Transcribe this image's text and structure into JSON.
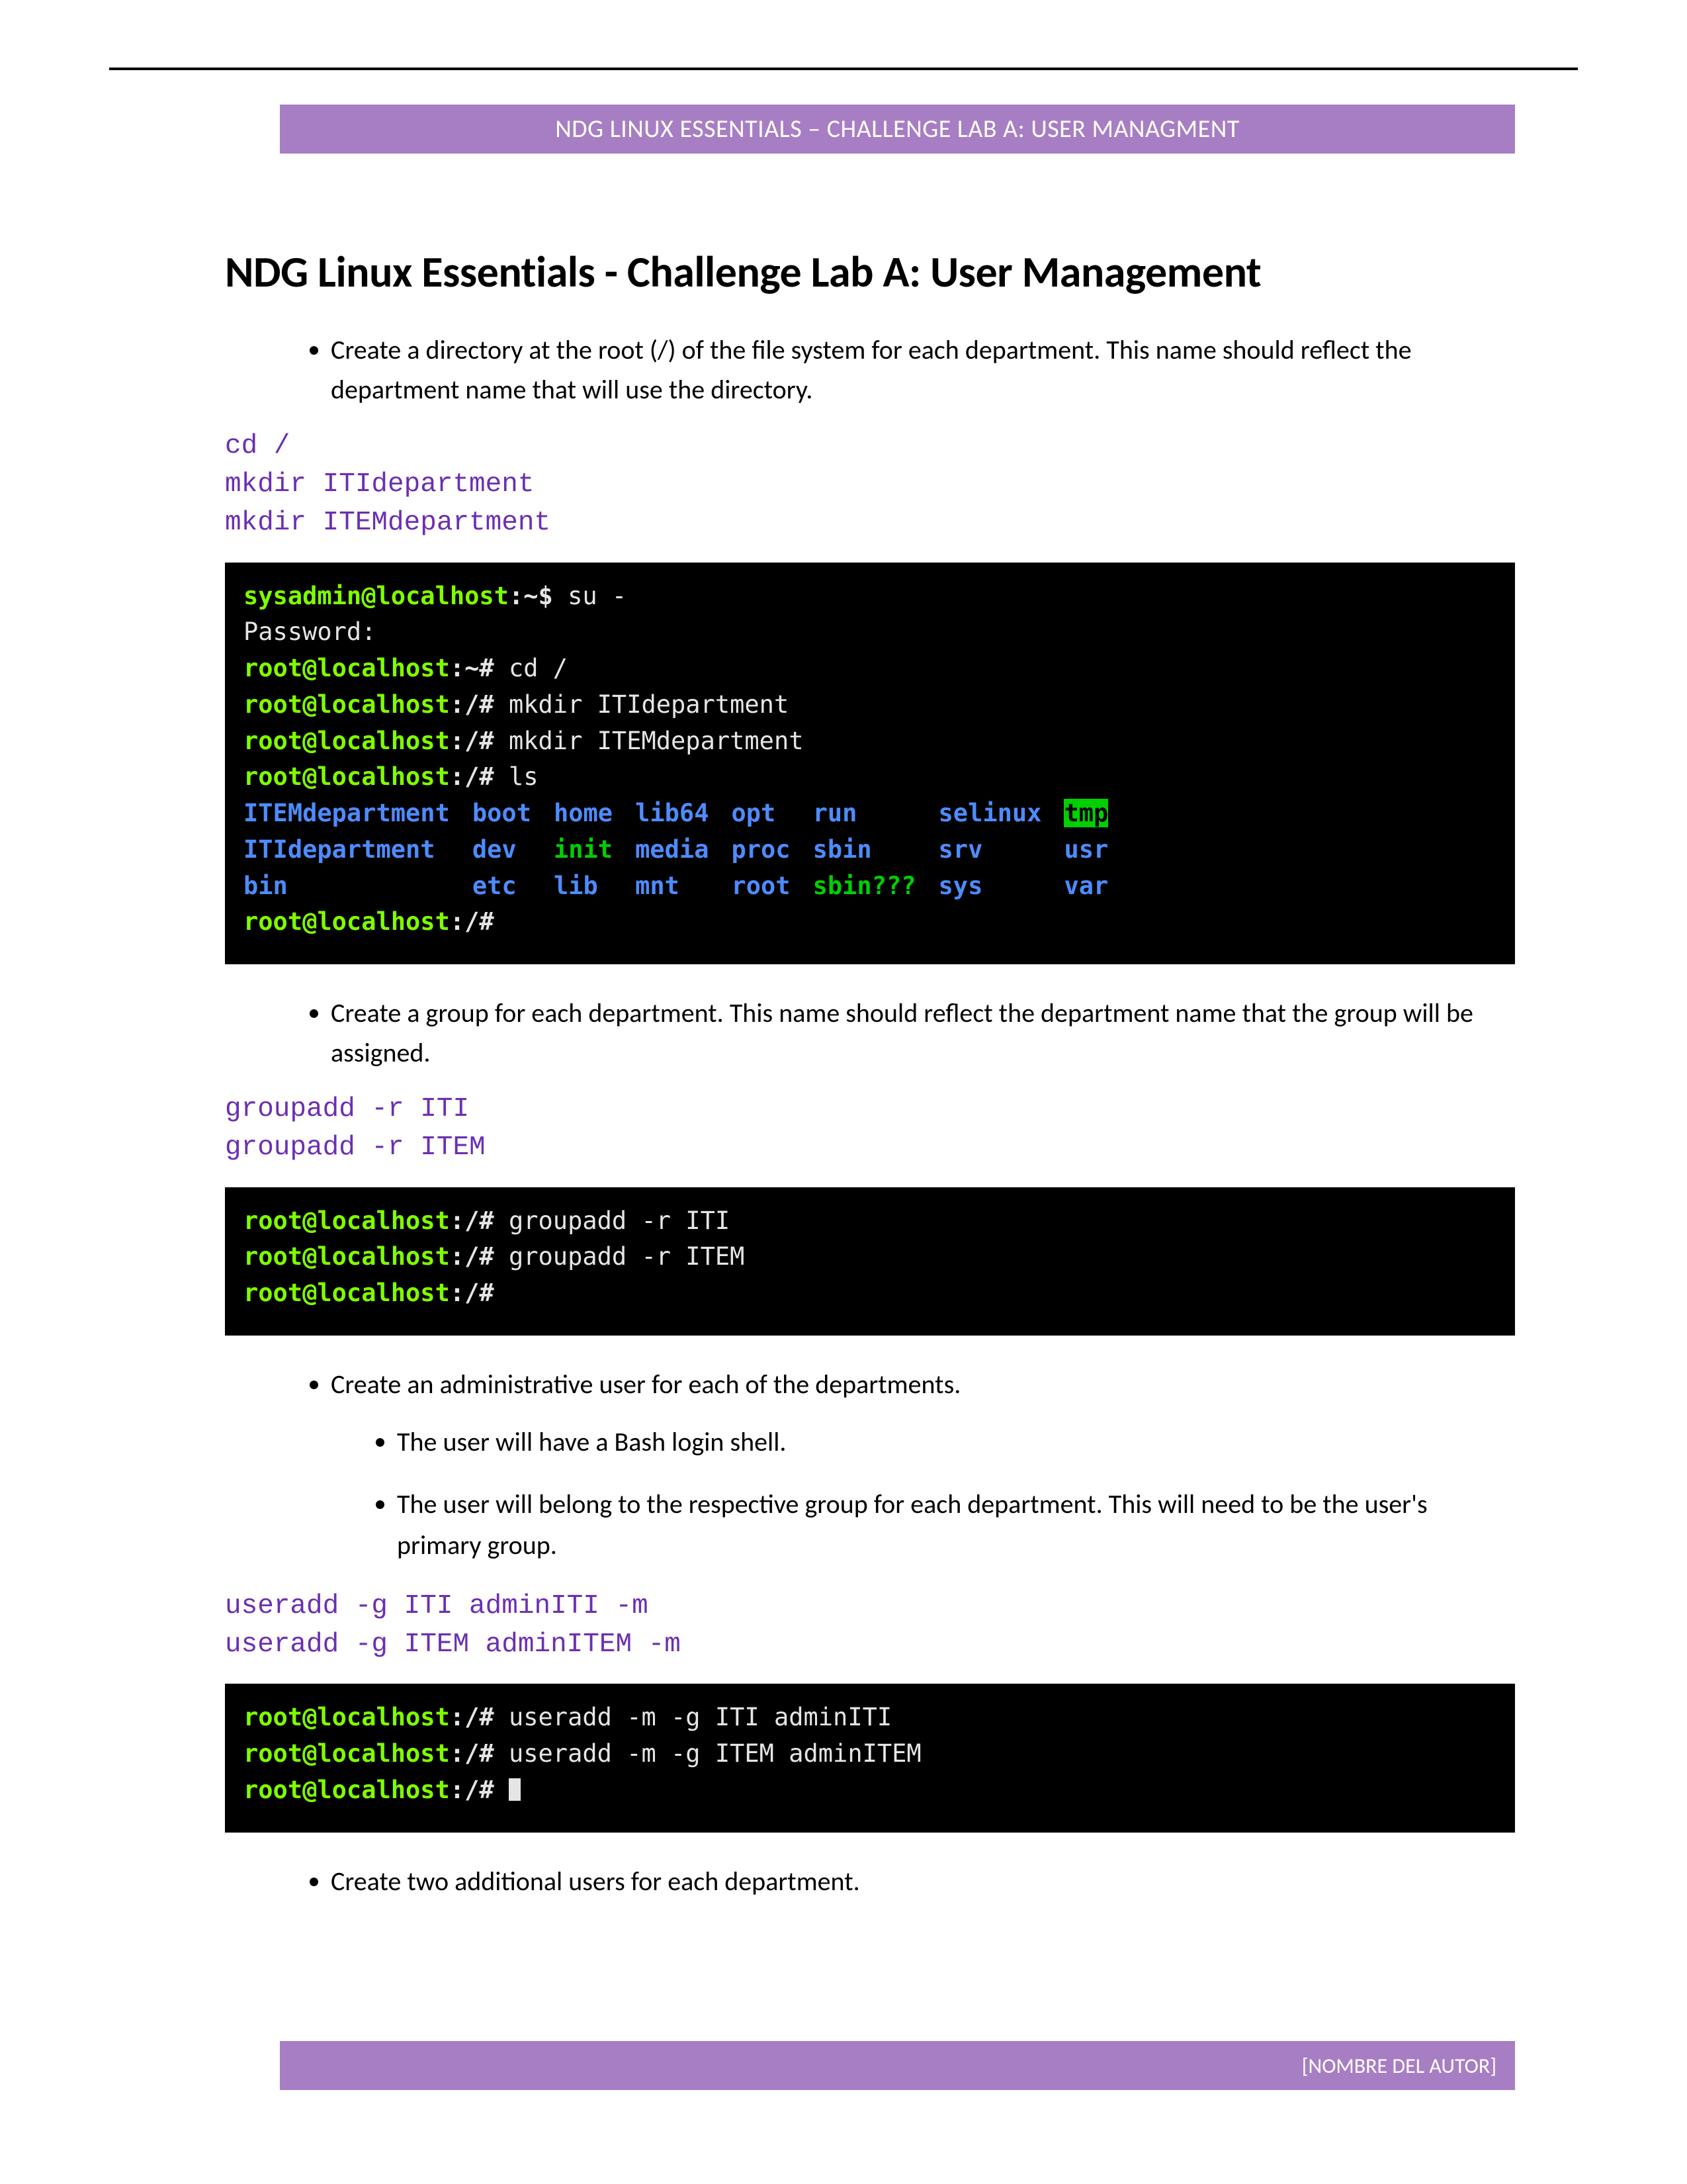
{
  "header": "NDG LINUX ESSENTIALS – CHALLENGE LAB A: USER MANAGMENT",
  "title": "NDG Linux Essentials - Challenge Lab A: User Management",
  "bullets": {
    "b1": "Create a directory at the root (/) of the file system for each department. This name should reflect the department name that will use the directory.",
    "b2": "Create a group for each department. This name should reflect the department name that the group will be assigned.",
    "b3": "Create an administrative user for each of the departments.",
    "b3a": "The user will have a Bash login shell.",
    "b3b": "The user will belong to the respective group for each department. This will need to be the user's primary group.",
    "b4": "Create two additional users for each department."
  },
  "cmds": {
    "c1l1": "cd /",
    "c1l2": "mkdir ITIdepartment",
    "c1l3": "mkdir ITEMdepartment",
    "c2l1": "groupadd -r ITI",
    "c2l2": "groupadd -r ITEM",
    "c3l1": "useradd -g ITI adminITI -m",
    "c3l2": "useradd -g ITEM adminITEM -m"
  },
  "term1": {
    "p_sys": "sysadmin@localhost",
    "p_sys_suffix": ":~$ ",
    "p_root": "root@localhost",
    "p_root_home": ":~# ",
    "p_root_slash": ":/# ",
    "l1": "su -",
    "l2": "Password:",
    "l3": "cd /",
    "l4": "mkdir ITIdepartment",
    "l5": "mkdir ITEMdepartment",
    "l6": "ls",
    "ls": {
      "r1": [
        "ITEMdepartment",
        "boot",
        "home",
        "lib64",
        "opt",
        "run",
        "selinux",
        "tmp"
      ],
      "r2": [
        "ITIdepartment",
        "dev",
        "init",
        "media",
        "proc",
        "sbin",
        "srv",
        "usr"
      ],
      "r3": [
        "bin",
        "etc",
        "lib",
        "mnt",
        "root",
        "sbin???",
        "sys",
        "var"
      ],
      "colors": {
        "r1": [
          "blue",
          "blue",
          "blue",
          "blue",
          "blue",
          "blue",
          "blue",
          "hl"
        ],
        "r2": [
          "blue",
          "blue",
          "green",
          "blue",
          "blue",
          "blue",
          "blue",
          "blue"
        ],
        "r3": [
          "blue",
          "blue",
          "blue",
          "blue",
          "blue",
          "green",
          "blue",
          "blue"
        ]
      }
    }
  },
  "term2": {
    "p_root": "root@localhost",
    "p_root_slash": ":/# ",
    "l1": "groupadd -r ITI",
    "l2": "groupadd -r ITEM"
  },
  "term3": {
    "p_root": "root@localhost",
    "p_root_slash": ":/# ",
    "l1": "useradd -m -g ITI adminITI",
    "l2": "useradd -m -g ITEM adminITEM"
  },
  "footer": "[NOMBRE DEL AUTOR]"
}
